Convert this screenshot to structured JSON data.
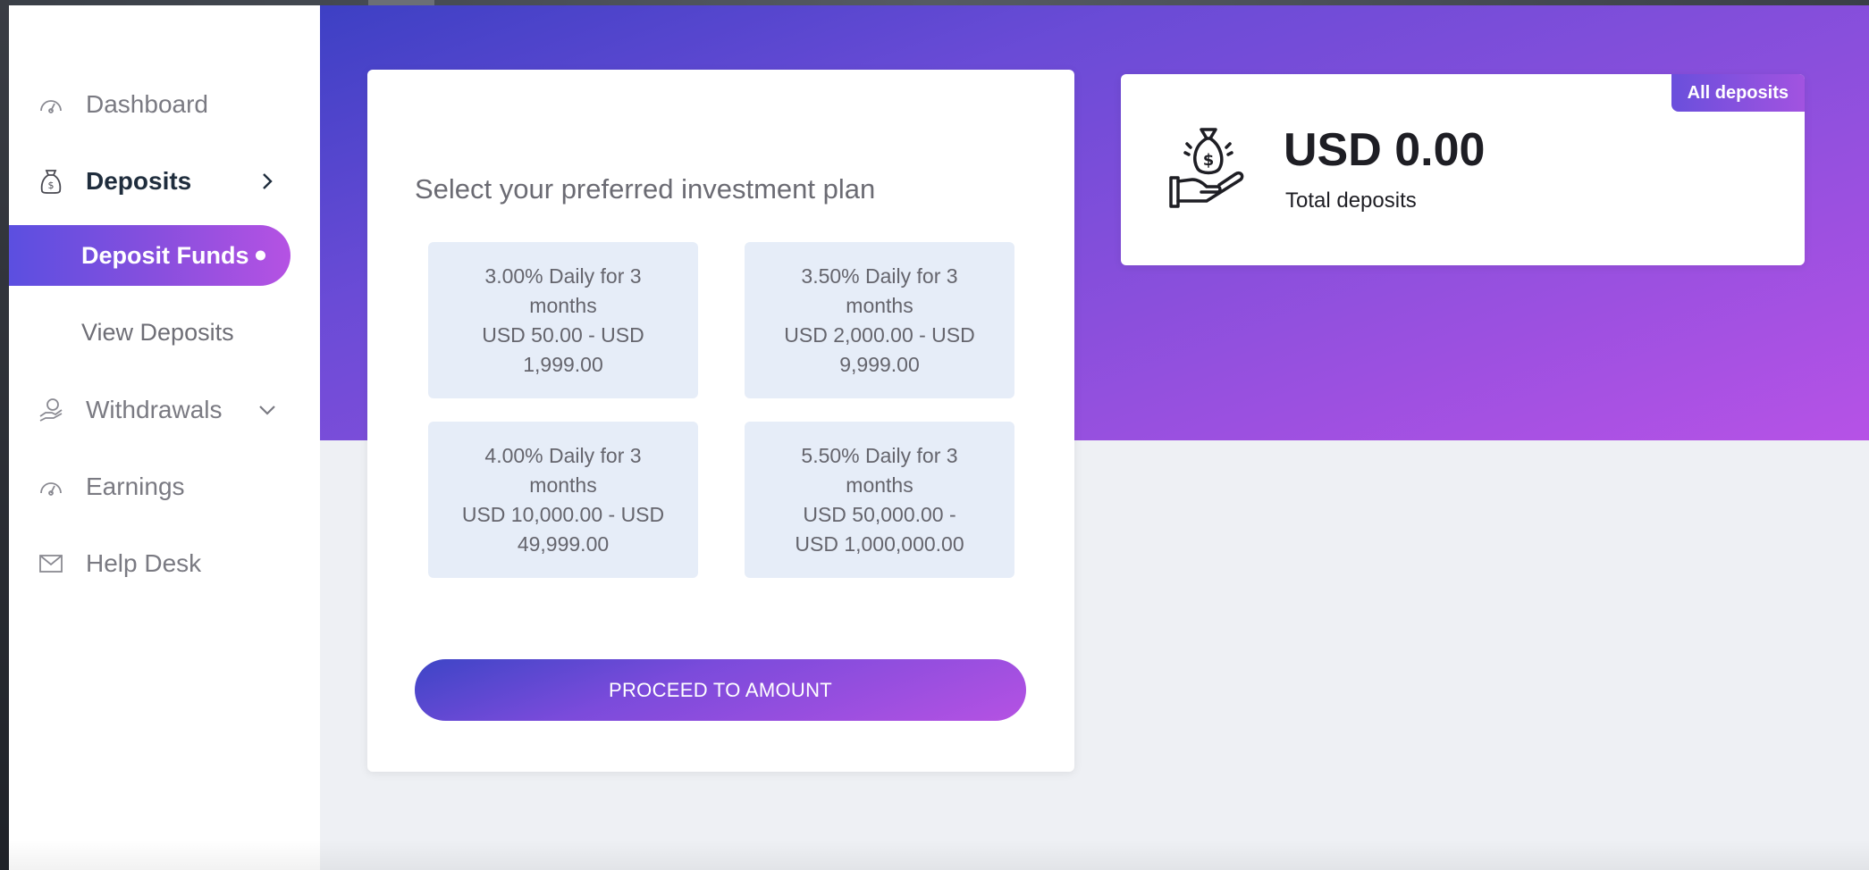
{
  "sidebar": {
    "items": [
      {
        "label": "Dashboard",
        "icon": "gauge-icon"
      },
      {
        "label": "Deposits",
        "icon": "money-bag-icon",
        "arrow": "chevron-right-icon"
      },
      {
        "label": "Deposit Funds",
        "active": true
      },
      {
        "label": "View Deposits"
      },
      {
        "label": "Withdrawals",
        "icon": "hand-coins-icon",
        "arrow": "chevron-down-icon"
      },
      {
        "label": "Earnings",
        "icon": "gauge-icon"
      },
      {
        "label": "Help Desk",
        "icon": "envelope-icon"
      }
    ]
  },
  "plans": {
    "title": "Select your preferred investment plan",
    "options": [
      {
        "line1": "3.00% Daily for 3",
        "line2": "months",
        "line3": "USD 50.00 - USD",
        "line4": "1,999.00"
      },
      {
        "line1": "3.50% Daily for 3",
        "line2": "months",
        "line3": "USD 2,000.00 - USD",
        "line4": "9,999.00"
      },
      {
        "line1": "4.00% Daily for 3",
        "line2": "months",
        "line3": "USD 10,000.00 - USD",
        "line4": "49,999.00"
      },
      {
        "line1": "5.50% Daily for 3",
        "line2": "months",
        "line3": "USD 50,000.00 -",
        "line4": "USD 1,000,000.00"
      }
    ],
    "proceed_label": "PROCEED TO AMOUNT"
  },
  "stats": {
    "amount": "USD 0.00",
    "label": "Total deposits",
    "badge": "All deposits",
    "icon": "money-bag-hand-icon"
  },
  "colors": {
    "accent_start": "#3d40c4",
    "accent_end": "#b652e6",
    "plan_bg": "#e6edf8"
  }
}
